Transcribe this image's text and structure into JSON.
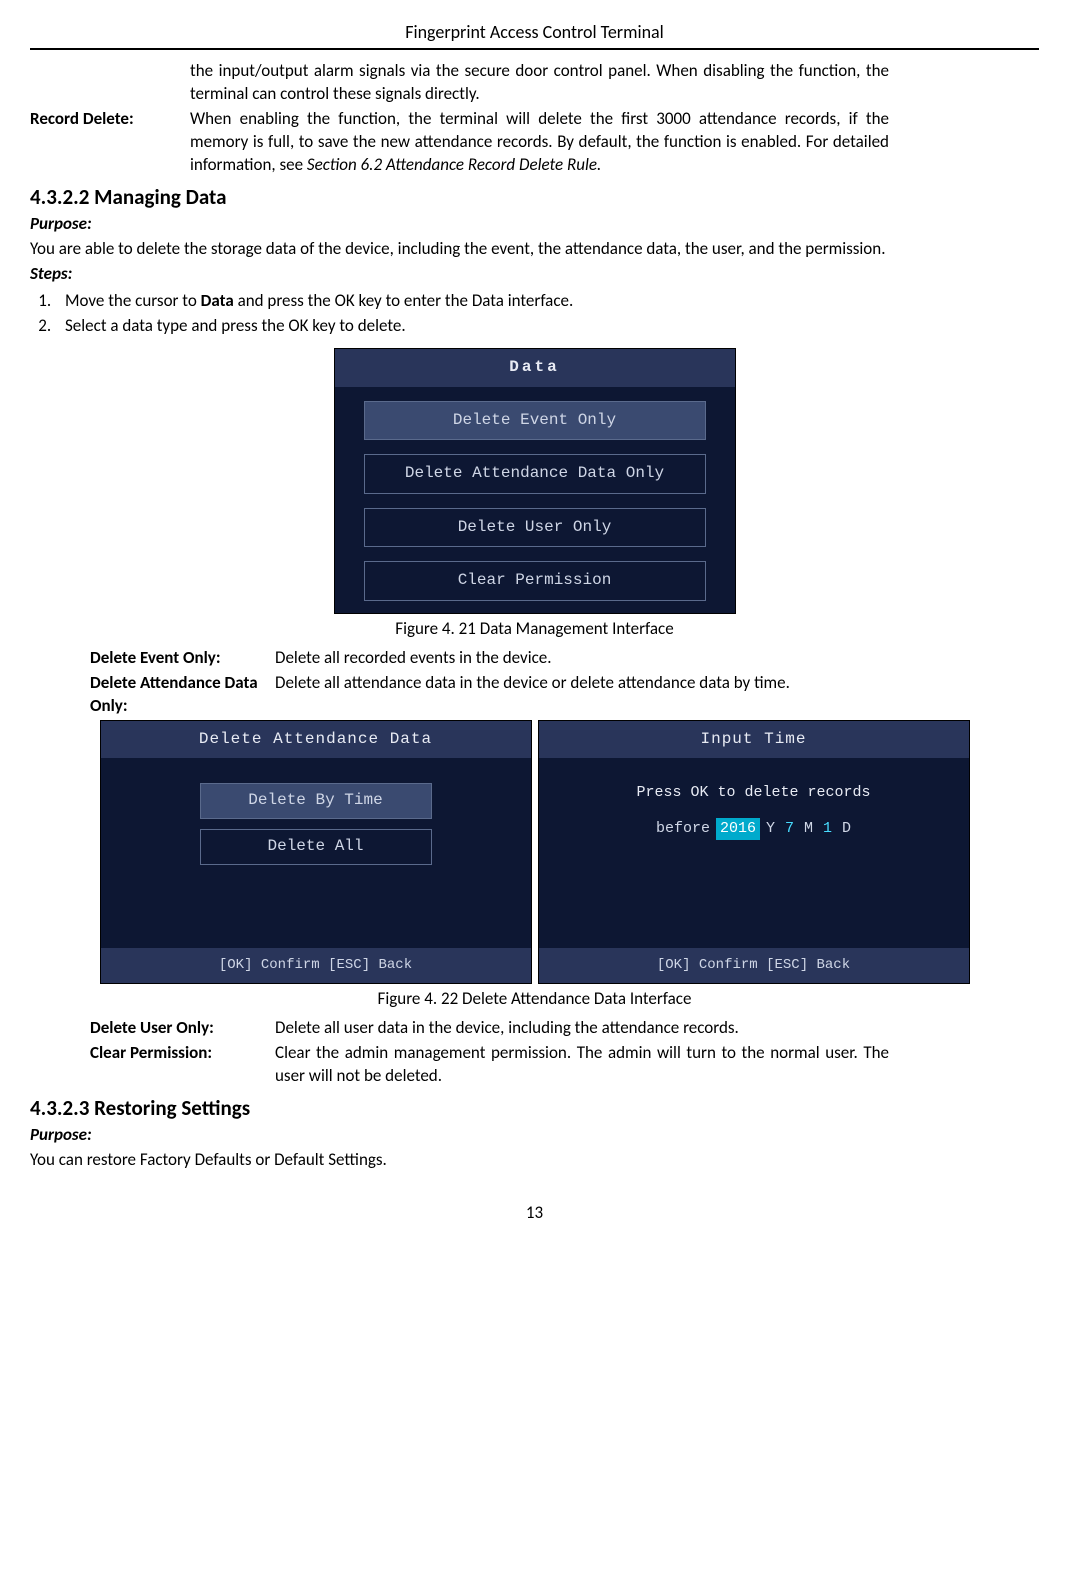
{
  "header": "Fingerprint Access Control Terminal",
  "intro_para": "the input/output alarm signals via the secure door control panel. When disabling the function, the terminal can control these signals directly.",
  "record_delete": {
    "label": "Record Delete:",
    "desc": "When enabling the function, the terminal will delete the first 3000 attendance records, if the memory is full, to save the new attendance records. By default, the function is enabled. For detailed information, see ",
    "ref": "Section 6.2 Attendance Record Delete Rule."
  },
  "sec4322": {
    "heading": "4.3.2.2 Managing Data",
    "purpose_label": "Purpose:",
    "purpose_text": "You are able to delete the storage data of the device, including the event, the attendance data, the user, and the permission.",
    "steps_label": "Steps:",
    "step1_pre": "Move the cursor to ",
    "step1_bold": "Data",
    "step1_post": " and press the OK key to enter the Data interface.",
    "step2": "Select a data type and press the OK key to delete."
  },
  "fig21": {
    "title": "Data",
    "items": [
      "Delete Event Only",
      "Delete Attendance Data Only",
      "Delete User Only",
      "Clear Permission"
    ],
    "caption": "Figure 4. 21 Data Management Interface"
  },
  "defs1": {
    "r1_label": "Delete Event Only:",
    "r1_desc": "Delete all recorded events in the device.",
    "r2_label": "Delete Attendance Data Only:",
    "r2_desc": "Delete all attendance data in the device or delete attendance data by time."
  },
  "fig22": {
    "left_title": "Delete Attendance Data",
    "right_title": "Input Time",
    "opt1": "Delete By Time",
    "opt2": "Delete All",
    "prompt": "Press OK to delete records",
    "before": "before",
    "year": "2016",
    "y": "Y",
    "month": "7",
    "m": "M",
    "day": "1",
    "d": "D",
    "footer": "[OK] Confirm   [ESC] Back",
    "caption": "Figure 4. 22 Delete Attendance Data Interface"
  },
  "defs2": {
    "r1_label": "Delete User Only:",
    "r1_desc": "Delete all user data in the device, including the attendance records.",
    "r2_label": "Clear Permission:",
    "r2_desc": "Clear the admin management permission. The admin will turn to the normal user. The user will not be deleted."
  },
  "sec4323": {
    "heading": "4.3.2.3 Restoring Settings",
    "purpose_label": "Purpose:",
    "purpose_text": "You can restore Factory Defaults or Default Settings."
  },
  "page_number": "13"
}
